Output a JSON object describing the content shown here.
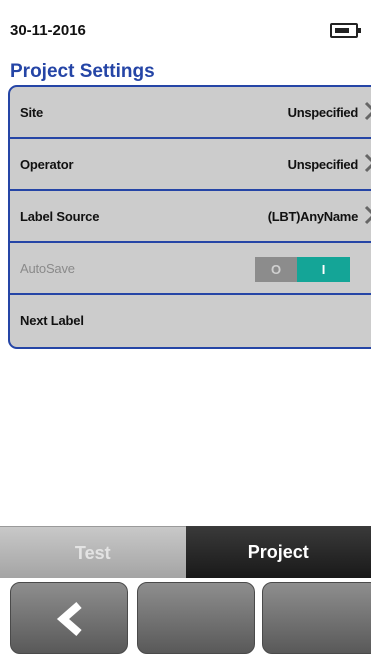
{
  "status": {
    "date": "30-11-2016",
    "battery_icon": "battery-icon"
  },
  "title": "Project Settings",
  "rows": [
    {
      "label": "Site",
      "value": "Unspecified"
    },
    {
      "label": "Operator",
      "value": "Unspecified"
    },
    {
      "label": "Label Source",
      "value": "(LBT)AnyName"
    },
    {
      "label": "AutoSave",
      "toggle_off": "O",
      "toggle_on": "I",
      "state": "on"
    },
    {
      "label": "Next Label"
    }
  ],
  "tabs": [
    {
      "label": "Test",
      "active": false
    },
    {
      "label": "Project",
      "active": true
    }
  ],
  "softkeys": {
    "back_icon": "chevron-left-icon"
  },
  "colors": {
    "accent": "#2545a6",
    "toggle_on": "#14a597",
    "panel": "#cccccc"
  }
}
